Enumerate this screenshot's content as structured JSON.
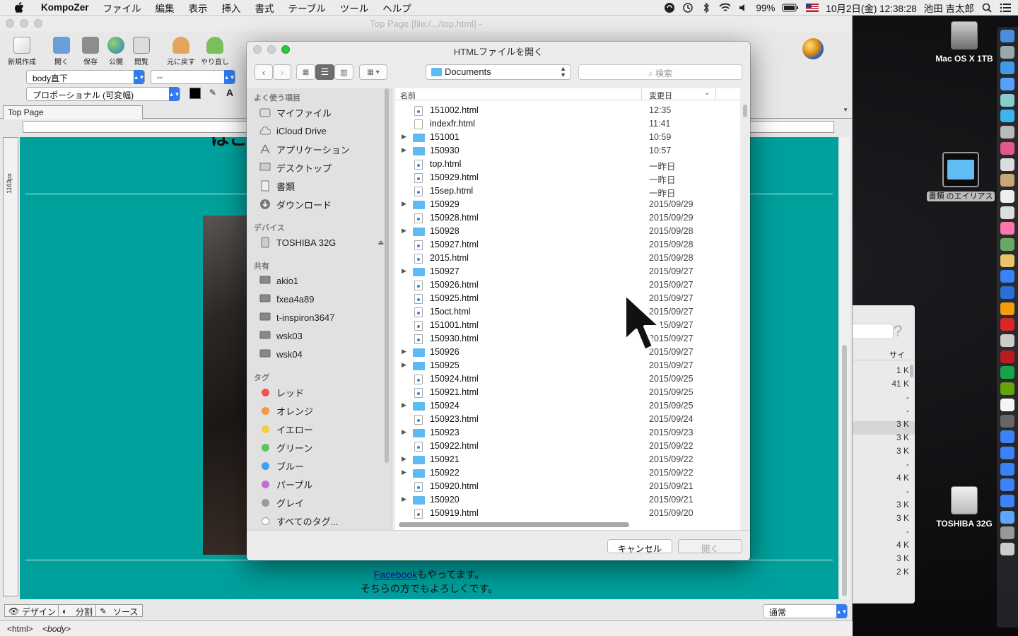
{
  "menubar": {
    "app_name": "KompoZer",
    "items": [
      "ファイル",
      "編集",
      "表示",
      "挿入",
      "書式",
      "テーブル",
      "ツール",
      "ヘルプ"
    ],
    "battery": "99%",
    "datetime": "10月2日(金) 12:38:28",
    "user": "池田 吉太郎"
  },
  "main_window": {
    "title": "Top Page [file:/.../top.html] -",
    "toolbar": [
      "新規作成",
      "開く",
      "保存",
      "公開",
      "閲覧",
      "元に戻す",
      "やり直し"
    ],
    "paragraph_select": "body直下",
    "style_select": "--",
    "font_select": "プロポーショナル (可変幅)",
    "tab": "Top Page",
    "ruler_label": "1163px",
    "editor": {
      "heading_fragment": "はこ",
      "link_text": "Facebook",
      "line1_rest": "もやってます。",
      "line2": "そちらの方でもよろしくです。",
      "background": "#00a09c"
    },
    "modes": [
      "デザイン",
      "分割",
      "ソース"
    ],
    "view_select": "通常",
    "status": [
      "<html>",
      "<body>"
    ]
  },
  "dialog": {
    "title": "HTMLファイルを開く",
    "location": "Documents",
    "search_placeholder": "検索",
    "col_name": "名前",
    "col_modified": "変更日",
    "sidebar": {
      "favorites_header": "よく使う項目",
      "favorites": [
        {
          "label": "マイファイル",
          "icon": "all-files-icon"
        },
        {
          "label": "iCloud Drive",
          "icon": "cloud-icon"
        },
        {
          "label": "アプリケーション",
          "icon": "applications-icon"
        },
        {
          "label": "デスクトップ",
          "icon": "desktop-icon"
        },
        {
          "label": "書類",
          "icon": "documents-icon"
        },
        {
          "label": "ダウンロード",
          "icon": "download-icon"
        }
      ],
      "devices_header": "デバイス",
      "devices": [
        {
          "label": "TOSHIBA 32G",
          "icon": "drive-icon"
        }
      ],
      "shared_header": "共有",
      "shared": [
        "akio1",
        "fxea4a89",
        "t-inspiron3647",
        "wsk03",
        "wsk04"
      ],
      "tags_header": "タグ",
      "tags": [
        {
          "label": "レッド",
          "color": "#f0524f"
        },
        {
          "label": "オレンジ",
          "color": "#f3993d"
        },
        {
          "label": "イエロー",
          "color": "#f7cd46"
        },
        {
          "label": "グリーン",
          "color": "#5fc35a"
        },
        {
          "label": "ブルー",
          "color": "#3fa0f0"
        },
        {
          "label": "パープル",
          "color": "#c56bd8"
        },
        {
          "label": "グレイ",
          "color": "#9a9a9a"
        },
        {
          "label": "すべてのタグ...",
          "color": "#ffffff"
        }
      ]
    },
    "files": [
      {
        "name": "151002.html",
        "date": "12:35",
        "type": "html"
      },
      {
        "name": "indexfr.html",
        "date": "11:41",
        "type": "doc"
      },
      {
        "name": "151001",
        "date": "10:59",
        "type": "folder"
      },
      {
        "name": "150930",
        "date": "10:57",
        "type": "folder"
      },
      {
        "name": "top.html",
        "date": "一昨日",
        "type": "html"
      },
      {
        "name": "150929.html",
        "date": "一昨日",
        "type": "html"
      },
      {
        "name": "15sep.html",
        "date": "一昨日",
        "type": "html"
      },
      {
        "name": "150929",
        "date": "2015/09/29",
        "type": "folder"
      },
      {
        "name": "150928.html",
        "date": "2015/09/29",
        "type": "html"
      },
      {
        "name": "150928",
        "date": "2015/09/28",
        "type": "folder"
      },
      {
        "name": "150927.html",
        "date": "2015/09/28",
        "type": "html"
      },
      {
        "name": "2015.html",
        "date": "2015/09/28",
        "type": "html"
      },
      {
        "name": "150927",
        "date": "2015/09/27",
        "type": "folder"
      },
      {
        "name": "150926.html",
        "date": "2015/09/27",
        "type": "html"
      },
      {
        "name": "150925.html",
        "date": "2015/09/27",
        "type": "html"
      },
      {
        "name": "15oct.html",
        "date": "2015/09/27",
        "type": "html"
      },
      {
        "name": "151001.html",
        "date": "2015/09/27",
        "type": "html"
      },
      {
        "name": "150930.html",
        "date": "2015/09/27",
        "type": "html"
      },
      {
        "name": "150926",
        "date": "2015/09/27",
        "type": "folder"
      },
      {
        "name": "150925",
        "date": "2015/09/27",
        "type": "folder"
      },
      {
        "name": "150924.html",
        "date": "2015/09/25",
        "type": "html"
      },
      {
        "name": "150921.html",
        "date": "2015/09/25",
        "type": "html"
      },
      {
        "name": "150924",
        "date": "2015/09/25",
        "type": "folder"
      },
      {
        "name": "150923.html",
        "date": "2015/09/24",
        "type": "html"
      },
      {
        "name": "150923",
        "date": "2015/09/23",
        "type": "folder"
      },
      {
        "name": "150922.html",
        "date": "2015/09/22",
        "type": "html"
      },
      {
        "name": "150921",
        "date": "2015/09/22",
        "type": "folder"
      },
      {
        "name": "150922",
        "date": "2015/09/22",
        "type": "folder"
      },
      {
        "name": "150920.html",
        "date": "2015/09/21",
        "type": "html"
      },
      {
        "name": "150920",
        "date": "2015/09/21",
        "type": "folder"
      },
      {
        "name": "150919.html",
        "date": "2015/09/20",
        "type": "html"
      }
    ],
    "cancel_label": "キャンセル",
    "open_label": "開く"
  },
  "background_window": {
    "col_size": "サイ",
    "sizes": [
      "1 K",
      "41 K",
      "-",
      "-",
      "3 K",
      "3 K",
      "3 K",
      "-",
      "4 K",
      "-",
      "3 K",
      "3 K",
      "-",
      "4 K",
      "3 K",
      "2 K"
    ]
  },
  "desktop": {
    "icons": [
      "Mac OS X 1TB",
      "書類 のエイリアス",
      "TOSHIBA 32G"
    ]
  }
}
